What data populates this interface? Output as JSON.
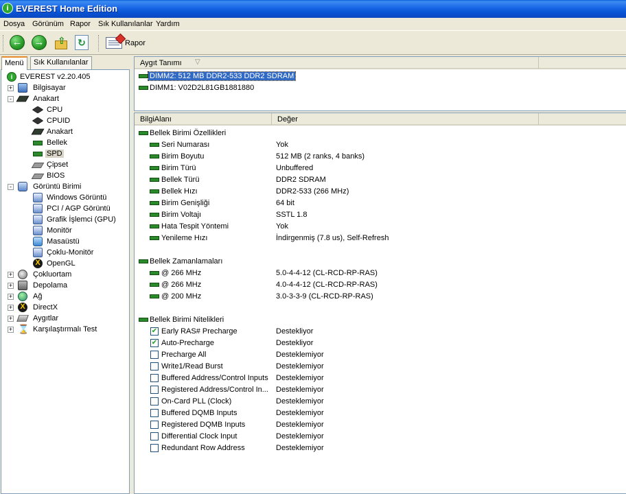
{
  "window": {
    "title": "EVEREST Home Edition"
  },
  "menu": [
    "Dosya",
    "Görünüm",
    "Rapor",
    "Sık Kullanılanlar",
    "Yardım"
  ],
  "toolbar": {
    "report_label": "Rapor"
  },
  "tabs": [
    "Menü",
    "Sık Kullanılanlar"
  ],
  "tree": [
    {
      "label": "EVEREST v2.20.405",
      "icon": "info-icon",
      "level": 0,
      "expander": ""
    },
    {
      "label": "Bilgisayar",
      "icon": "computer-icon",
      "level": 0,
      "expander": "+"
    },
    {
      "label": "Anakart",
      "icon": "motherboard-icon",
      "level": 0,
      "expander": "-"
    },
    {
      "label": "CPU",
      "icon": "cpu-icon",
      "level": 1,
      "expander": ""
    },
    {
      "label": "CPUID",
      "icon": "cpu-icon",
      "level": 1,
      "expander": ""
    },
    {
      "label": "Anakart",
      "icon": "motherboard-icon",
      "level": 1,
      "expander": ""
    },
    {
      "label": "Bellek",
      "icon": "memory-icon",
      "level": 1,
      "expander": ""
    },
    {
      "label": "SPD",
      "icon": "memory-icon",
      "level": 1,
      "expander": "",
      "selected": true
    },
    {
      "label": "Çipset",
      "icon": "chipset-icon",
      "level": 1,
      "expander": ""
    },
    {
      "label": "BIOS",
      "icon": "bios-icon",
      "level": 1,
      "expander": ""
    },
    {
      "label": "Görüntü Birimi",
      "icon": "display-icon",
      "level": 0,
      "expander": "-"
    },
    {
      "label": "Windows Görüntü",
      "icon": "monitor-icon",
      "level": 1,
      "expander": ""
    },
    {
      "label": "PCI / AGP Görüntü",
      "icon": "monitor-icon",
      "level": 1,
      "expander": ""
    },
    {
      "label": "Grafik İşlemci (GPU)",
      "icon": "monitor-icon",
      "level": 1,
      "expander": ""
    },
    {
      "label": "Monitör",
      "icon": "monitor-icon",
      "level": 1,
      "expander": ""
    },
    {
      "label": "Masaüstü",
      "icon": "desktop-icon",
      "level": 1,
      "expander": ""
    },
    {
      "label": "Çoklu-Monitör",
      "icon": "monitor-icon",
      "level": 1,
      "expander": ""
    },
    {
      "label": "OpenGL",
      "icon": "opengl-icon",
      "level": 1,
      "expander": ""
    },
    {
      "label": "Çokluortam",
      "icon": "multimedia-icon",
      "level": 0,
      "expander": "+"
    },
    {
      "label": "Depolama",
      "icon": "storage-icon",
      "level": 0,
      "expander": "+"
    },
    {
      "label": "Ağ",
      "icon": "network-icon",
      "level": 0,
      "expander": "+"
    },
    {
      "label": "DirectX",
      "icon": "directx-icon",
      "level": 0,
      "expander": "+"
    },
    {
      "label": "Aygıtlar",
      "icon": "devices-icon",
      "level": 0,
      "expander": "+"
    },
    {
      "label": "Karşılaştırmalı Test",
      "icon": "hourglass-icon",
      "level": 0,
      "expander": "+"
    }
  ],
  "device_list": {
    "header": "Aygıt Tanımı",
    "items": [
      {
        "label": "DIMM2: 512 MB DDR2-533 DDR2 SDRAM",
        "selected": true
      },
      {
        "label": "DIMM1: V02D2L81GB1881880",
        "selected": false
      }
    ]
  },
  "details": {
    "headers": {
      "field": "BilgiAlanı",
      "value": "Değer"
    },
    "rows": [
      {
        "kind": "section",
        "field": "Bellek Birimi Özellikleri",
        "value": ""
      },
      {
        "kind": "item",
        "field": "Seri Numarası",
        "value": "Yok"
      },
      {
        "kind": "item",
        "field": "Birim Boyutu",
        "value": "512 MB (2 ranks, 4 banks)"
      },
      {
        "kind": "item",
        "field": "Birim Türü",
        "value": "Unbuffered"
      },
      {
        "kind": "item",
        "field": "Bellek Türü",
        "value": "DDR2 SDRAM"
      },
      {
        "kind": "item",
        "field": "Bellek Hızı",
        "value": "DDR2-533 (266 MHz)"
      },
      {
        "kind": "item",
        "field": "Birim Genişliği",
        "value": "64 bit"
      },
      {
        "kind": "item",
        "field": "Birim Voltajı",
        "value": "SSTL 1.8"
      },
      {
        "kind": "item",
        "field": "Hata Tespit Yöntemi",
        "value": "Yok"
      },
      {
        "kind": "item",
        "field": "Yenileme Hızı",
        "value": "İndirgenmiş (7.8 us), Self-Refresh"
      },
      {
        "kind": "blank",
        "field": "",
        "value": ""
      },
      {
        "kind": "section",
        "field": "Bellek Zamanlamaları",
        "value": ""
      },
      {
        "kind": "item",
        "field": "@ 266 MHz",
        "value": "5.0-4-4-12  (CL-RCD-RP-RAS)"
      },
      {
        "kind": "item",
        "field": "@ 266 MHz",
        "value": "4.0-4-4-12  (CL-RCD-RP-RAS)"
      },
      {
        "kind": "item",
        "field": "@ 200 MHz",
        "value": "3.0-3-3-9  (CL-RCD-RP-RAS)"
      },
      {
        "kind": "blank",
        "field": "",
        "value": ""
      },
      {
        "kind": "section",
        "field": "Bellek Birimi Nitelikleri",
        "value": ""
      },
      {
        "kind": "check",
        "checked": true,
        "field": "Early RAS# Precharge",
        "value": "Destekliyor"
      },
      {
        "kind": "check",
        "checked": true,
        "field": "Auto-Precharge",
        "value": "Destekliyor"
      },
      {
        "kind": "check",
        "checked": false,
        "field": "Precharge All",
        "value": "Desteklemiyor"
      },
      {
        "kind": "check",
        "checked": false,
        "field": "Write1/Read Burst",
        "value": "Desteklemiyor"
      },
      {
        "kind": "check",
        "checked": false,
        "field": "Buffered Address/Control Inputs",
        "value": "Desteklemiyor"
      },
      {
        "kind": "check",
        "checked": false,
        "field": "Registered Address/Control In...",
        "value": "Desteklemiyor"
      },
      {
        "kind": "check",
        "checked": false,
        "field": "On-Card PLL (Clock)",
        "value": "Desteklemiyor"
      },
      {
        "kind": "check",
        "checked": false,
        "field": "Buffered DQMB Inputs",
        "value": "Desteklemiyor"
      },
      {
        "kind": "check",
        "checked": false,
        "field": "Registered DQMB Inputs",
        "value": "Desteklemiyor"
      },
      {
        "kind": "check",
        "checked": false,
        "field": "Differential Clock Input",
        "value": "Desteklemiyor"
      },
      {
        "kind": "check",
        "checked": false,
        "field": "Redundant Row Address",
        "value": "Desteklemiyor"
      }
    ]
  }
}
